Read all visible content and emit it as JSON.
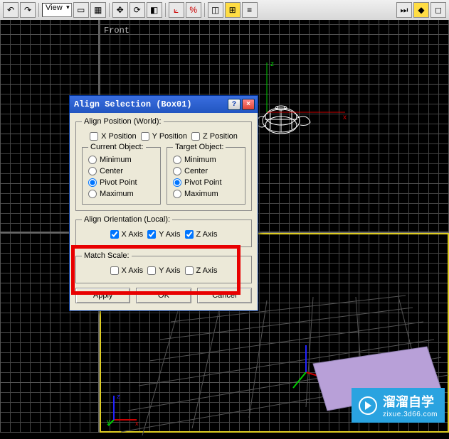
{
  "toolbar": {
    "view_label": "View"
  },
  "viewport": {
    "label_front": "Front"
  },
  "dialog": {
    "title": "Align Selection (Box01)",
    "help": "?",
    "close": "×",
    "position": {
      "legend": "Align Position (World):",
      "x": "X Position",
      "y": "Y Position",
      "z": "Z Position",
      "current_legend": "Current Object:",
      "target_legend": "Target Object:",
      "opt_min": "Minimum",
      "opt_center": "Center",
      "opt_pivot": "Pivot Point",
      "opt_max": "Maximum"
    },
    "orientation": {
      "legend": "Align Orientation (Local):",
      "x": "X Axis",
      "y": "Y Axis",
      "z": "Z Axis"
    },
    "scale": {
      "legend": "Match Scale:",
      "x": "X Axis",
      "y": "Y Axis",
      "z": "Z Axis"
    },
    "buttons": {
      "apply": "Apply",
      "ok": "OK",
      "cancel": "Cancel"
    }
  },
  "watermark": {
    "text": "溜溜自学",
    "sub": "zixue.3d66.com"
  }
}
